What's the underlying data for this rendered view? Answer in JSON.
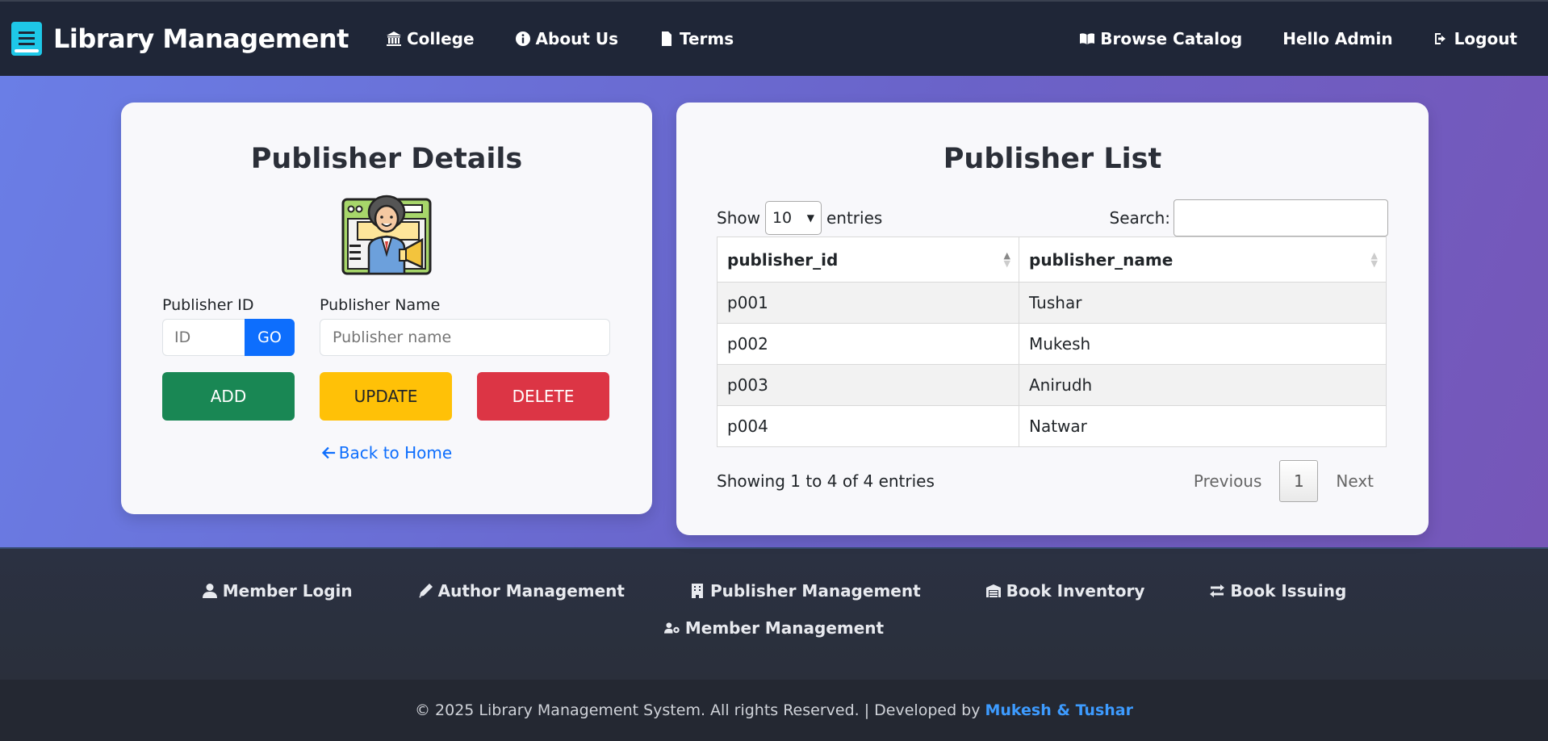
{
  "navbar": {
    "brand": "Library Management",
    "left_links": [
      {
        "label": "College",
        "icon": "university-icon"
      },
      {
        "label": "About Us",
        "icon": "info-circle-icon"
      },
      {
        "label": "Terms",
        "icon": "document-icon"
      }
    ],
    "right_links": [
      {
        "label": "Browse Catalog",
        "icon": "book-open-icon"
      },
      {
        "label": "Hello Admin",
        "icon": ""
      },
      {
        "label": "Logout",
        "icon": "logout-icon"
      }
    ]
  },
  "details_card": {
    "title": "Publisher Details",
    "illustration": "publisher-megaphone-icon",
    "id_label": "Publisher ID",
    "id_placeholder": "ID",
    "go_label": "GO",
    "name_label": "Publisher Name",
    "name_placeholder": "Publisher name",
    "add_label": "ADD",
    "update_label": "UPDATE",
    "delete_label": "DELETE",
    "back_label": "Back to Home"
  },
  "list_card": {
    "title": "Publisher List",
    "show_label": "Show",
    "length_value": "10",
    "entries_label": "entries",
    "search_label": "Search:",
    "columns": [
      "publisher_id",
      "publisher_name"
    ],
    "rows": [
      [
        "p001",
        "Tushar"
      ],
      [
        "p002",
        "Mukesh"
      ],
      [
        "p003",
        "Anirudh"
      ],
      [
        "p004",
        "Natwar"
      ]
    ],
    "info": "Showing 1 to 4 of 4 entries",
    "prev_label": "Previous",
    "current_page": "1",
    "next_label": "Next"
  },
  "footer": {
    "links": [
      {
        "label": "Member Login",
        "icon": "user-icon"
      },
      {
        "label": "Author Management",
        "icon": "pen-icon"
      },
      {
        "label": "Publisher Management",
        "icon": "building-icon"
      },
      {
        "label": "Book Inventory",
        "icon": "warehouse-icon"
      },
      {
        "label": "Book Issuing",
        "icon": "exchange-icon"
      },
      {
        "label": "Member Management",
        "icon": "users-cog-icon"
      }
    ],
    "copyright": "© 2025 Library Management System. All rights Reserved. | Developed by",
    "developers": "Mukesh & Tushar"
  },
  "colors": {
    "navbar": "#1f2637",
    "primary": "#0d6efd",
    "success": "#198754",
    "warning": "#ffc107",
    "danger": "#dc3545",
    "brand_icon": "#1ec8e8"
  }
}
